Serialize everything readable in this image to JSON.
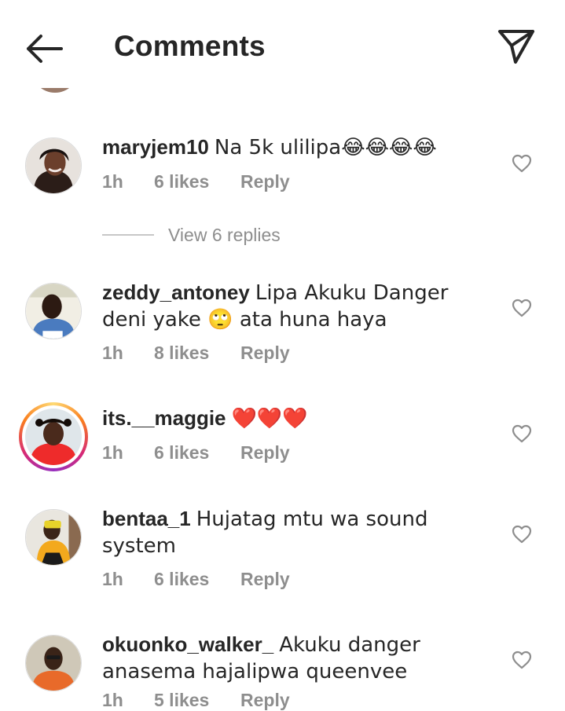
{
  "header": {
    "title": "Comments"
  },
  "view_replies": {
    "label": "View 6 replies"
  },
  "comments": [
    {
      "username": "maryjem10",
      "text": "Na 5k ulilipa😂😂😂😂",
      "time": "1h",
      "likes": "6 likes",
      "reply": "Reply"
    },
    {
      "username": "zeddy_antoney",
      "text": "Lipa Akuku Danger deni yake 🙄 ata huna haya",
      "time": "1h",
      "likes": "8 likes",
      "reply": "Reply"
    },
    {
      "username": "its.__maggie",
      "text": "❤️❤️❤️",
      "time": "1h",
      "likes": "6 likes",
      "reply": "Reply"
    },
    {
      "username": "bentaa_1",
      "text": "Hujatag mtu wa sound system",
      "time": "1h",
      "likes": "6 likes",
      "reply": "Reply"
    },
    {
      "username": "okuonko_walker_",
      "text": "Akuku danger anasema hajalipwa queenvee",
      "time": "1h",
      "likes": "5 likes",
      "reply": "Reply"
    }
  ],
  "colors": {
    "text_primary": "#262626",
    "text_secondary": "#8e8e8e",
    "heart_red": "#e0192f"
  },
  "icons": {
    "back": "arrow-left-icon",
    "send": "paper-plane-icon",
    "like": "heart-outline-icon"
  }
}
